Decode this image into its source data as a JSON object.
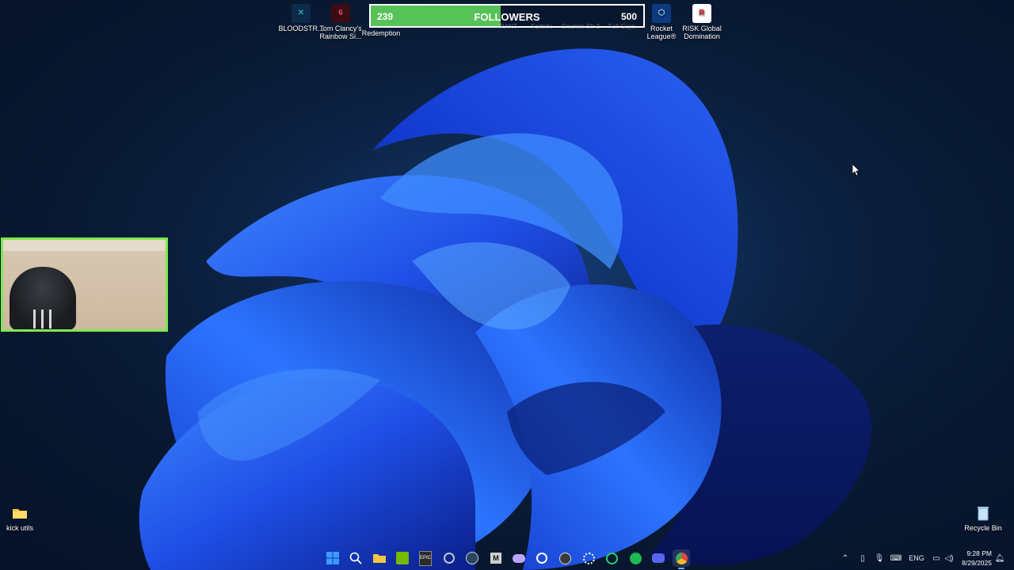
{
  "desktop": {
    "top_icons": [
      {
        "label": "BLOODSTR...",
        "icon": "bloodstrike-icon",
        "color": "#1ab3c7"
      },
      {
        "label": "Tom Clancy's Rainbow Si...",
        "icon": "rainbow-six-icon",
        "color": "#c8203a"
      },
      {
        "label": "Redemption",
        "icon": "red-dead-redemption-icon",
        "color": "#8b1a1a"
      },
      {
        "label": "RANT",
        "icon": "valorant-icon",
        "color": "#ff4655"
      },
      {
        "label": "Fortnite",
        "icon": "fortnite-icon",
        "color": "#3a6db5"
      },
      {
        "label": "Counter-Str 2",
        "icon": "counter-strike-icon",
        "color": "#e29a2b"
      },
      {
        "label": "Fall Guys",
        "icon": "fall-guys-icon",
        "color": "#4a8fd8"
      },
      {
        "label": "Rocket League®",
        "icon": "rocket-league-icon",
        "color": "#1c6fd1"
      },
      {
        "label": "RISK Global Domination",
        "icon": "risk-icon",
        "color": "#d81f26"
      }
    ],
    "side_icons": {
      "kick_utils": {
        "label": "kick utils",
        "icon": "folder-icon"
      },
      "recycle_bin": {
        "label": "Recycle Bin",
        "icon": "recycle-bin-icon"
      }
    }
  },
  "followers_goal": {
    "current": "239",
    "title": "FOLLOWERS",
    "goal": "500",
    "progress": 0.478,
    "fill_color": "#57c257"
  },
  "webcam": {
    "border_color": "#7dea4e"
  },
  "taskbar": {
    "pinned": [
      {
        "name": "start",
        "icon": "windows-start-icon",
        "color": "#3b9cff"
      },
      {
        "name": "search",
        "icon": "search-icon",
        "color": "#ffffff"
      },
      {
        "name": "file-explorer",
        "icon": "folder-icon",
        "color": "#f4c542"
      },
      {
        "name": "nvidia",
        "icon": "nvidia-icon",
        "color": "#76b900"
      },
      {
        "name": "epic-games",
        "icon": "epic-games-icon",
        "color": "#2a2a2a"
      },
      {
        "name": "ea-app",
        "icon": "ea-app-icon",
        "color": "#bfc6d4"
      },
      {
        "name": "steam",
        "icon": "steam-icon",
        "color": "#1b2838"
      },
      {
        "name": "battle-state",
        "icon": "game-launcher-icon",
        "color": "#cfcfcf"
      },
      {
        "name": "gamepad",
        "icon": "gamepad-icon",
        "color": "#b9a6ff"
      },
      {
        "name": "ubisoft",
        "icon": "ubisoft-icon",
        "color": "#ffffff"
      },
      {
        "name": "obs",
        "icon": "obs-icon",
        "color": "#d9d9d9"
      },
      {
        "name": "chatgpt",
        "icon": "chatgpt-icon",
        "color": "#ffffff"
      },
      {
        "name": "whatsapp",
        "icon": "whatsapp-icon",
        "color": "#25d366"
      },
      {
        "name": "spotify",
        "icon": "spotify-icon",
        "color": "#1db954"
      },
      {
        "name": "discord",
        "icon": "discord-icon",
        "color": "#5865f2"
      },
      {
        "name": "chrome",
        "icon": "chrome-icon",
        "color": "#e8453c"
      }
    ],
    "tray": {
      "language": "ENG",
      "time": "9:28 PM",
      "date": "8/29/2025"
    }
  }
}
